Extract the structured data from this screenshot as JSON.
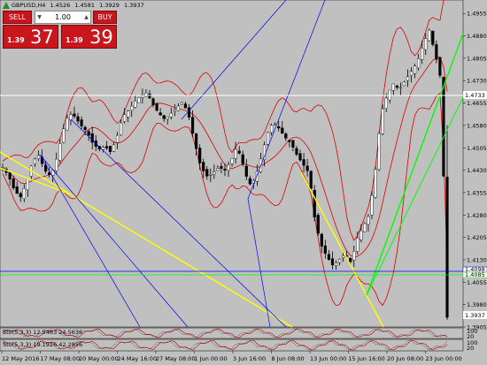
{
  "symbol_info": {
    "symbol": "GBPUSD,H4",
    "open": "1.4526",
    "high": "1.4581",
    "low": "1.3929",
    "close": "1.3937"
  },
  "trade_panel": {
    "sell_label": "SELL",
    "buy_label": "BUY",
    "lot": "1.00",
    "sell_small": "1.39",
    "sell_big": "37",
    "buy_small": "1.39",
    "buy_big": "39"
  },
  "price_axis": {
    "ticks": [
      "1.4955",
      "1.4880",
      "1.4805",
      "1.4730",
      "1.4655",
      "1.4580",
      "1.4505",
      "1.4430",
      "1.4355",
      "1.4280",
      "1.4205",
      "1.4130",
      "1.4055",
      "1.3980",
      "1.3905"
    ],
    "markers": {
      "white_line": "1.4733",
      "blue_line": "1.4098",
      "green_line": "1.4085",
      "current_price": "1.3937"
    }
  },
  "time_axis": {
    "labels": [
      "12 May 2016",
      "17 May 08:00",
      "20 May 00:00",
      "24 May 16:00",
      "27 May 08:00",
      "1 Jun 00:00",
      "3 Jun 16:00",
      "8 Jun 08:00",
      "13 Jun 00:00",
      "15 Jun 16:00",
      "20 Jun 08:00",
      "23 Jun 00:00"
    ]
  },
  "sub_windows": [
    {
      "label": "Sto(5,3,3) 12.5463 24.5636",
      "axis_top": "100",
      "axis_mid": "20"
    },
    {
      "label": "Sto(5,3,3) 19.1926 42.2856",
      "axis_top": "100",
      "axis_mid": "20"
    }
  ],
  "colors": {
    "background": "#c0c0c0",
    "bull_candle": "#ffffff",
    "bear_candle": "#000000",
    "bollinger": "#e00000",
    "trend_yellow": "#ffff00",
    "trend_green": "#00ff00",
    "fan_blue": "#0000ff",
    "sell_buy_panel": "#c9161c"
  },
  "chart_data": {
    "type": "candlestick",
    "symbol": "GBPUSD",
    "timeframe": "H4",
    "ylim": [
      1.3905,
      1.5
    ],
    "close_series": [
      1.444,
      1.441,
      1.436,
      1.434,
      1.439,
      1.446,
      1.448,
      1.443,
      1.441,
      1.447,
      1.456,
      1.462,
      1.461,
      1.458,
      1.456,
      1.452,
      1.45,
      1.451,
      1.449,
      1.454,
      1.461,
      1.463,
      1.466,
      1.468,
      1.469,
      1.465,
      1.462,
      1.46,
      1.462,
      1.464,
      1.466,
      1.461,
      1.452,
      1.444,
      1.441,
      1.442,
      1.444,
      1.443,
      1.446,
      1.451,
      1.445,
      1.438,
      1.44,
      1.447,
      1.455,
      1.459,
      1.457,
      1.454,
      1.452,
      1.448,
      1.445,
      1.442,
      1.426,
      1.418,
      1.414,
      1.411,
      1.413,
      1.415,
      1.412,
      1.42,
      1.424,
      1.428,
      1.442,
      1.462,
      1.468,
      1.472,
      1.47,
      1.473,
      1.476,
      1.479,
      1.485,
      1.49,
      1.482,
      1.473,
      1.3937
    ],
    "indicators": [
      "Bollinger Bands",
      "Stochastic(5,3,3)",
      "Stochastic(5,3,3)"
    ]
  }
}
